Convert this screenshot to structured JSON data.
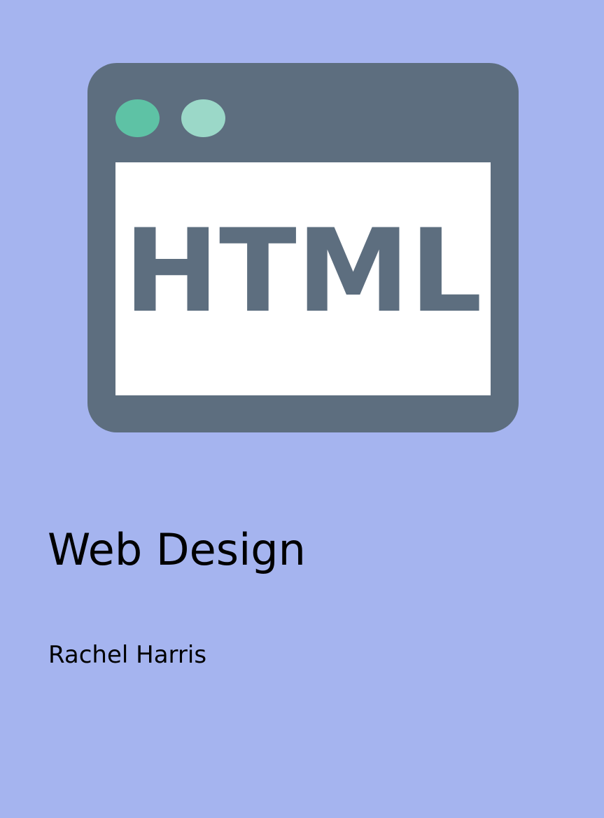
{
  "cover": {
    "title": "Web Design",
    "author": "Rachel Harris",
    "background_color": "#a5b4ef"
  },
  "illustration": {
    "icon": "browser-window-icon",
    "logo_text": "HTML",
    "frame_color": "#5d6e7f",
    "screen_color": "#ffffff",
    "dot_colors": [
      "#5ec2a5",
      "#9bd8c8"
    ]
  }
}
